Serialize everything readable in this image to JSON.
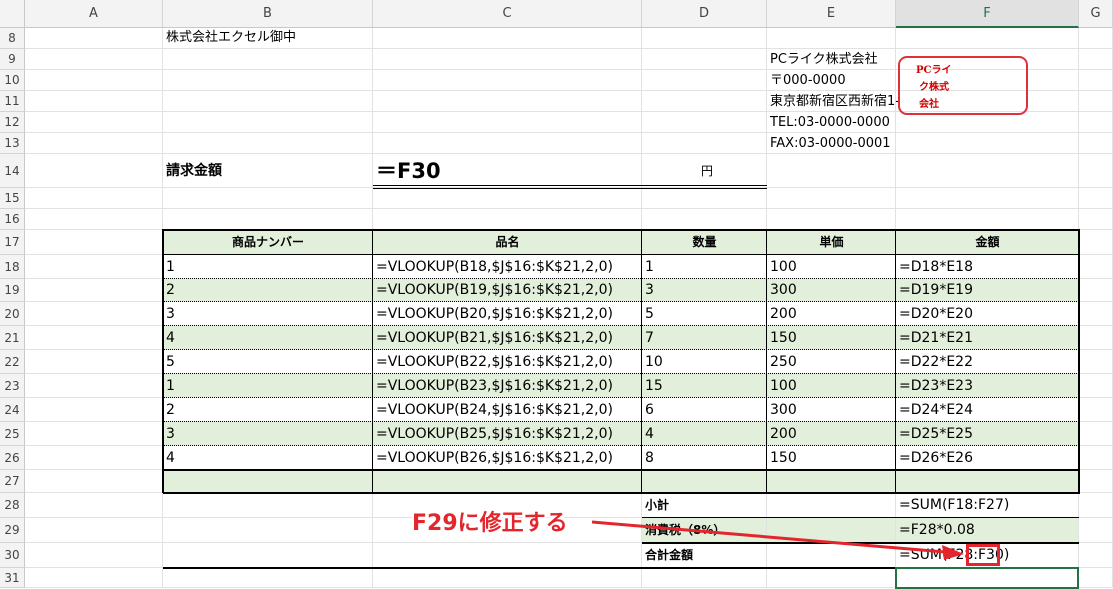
{
  "columns": [
    "A",
    "B",
    "C",
    "D",
    "E",
    "F",
    "G"
  ],
  "rows": [
    "8",
    "9",
    "10",
    "11",
    "12",
    "13",
    "14",
    "15",
    "16",
    "17",
    "18",
    "19",
    "20",
    "21",
    "22",
    "23",
    "24",
    "25",
    "26",
    "27",
    "28",
    "29",
    "30",
    "31"
  ],
  "selected_column": "F",
  "addressee": "株式会社エクセル御中",
  "company": {
    "name": "PCライク株式会社",
    "postal": "〒000-0000",
    "address": "東京都新宿区西新宿1-",
    "tel": "TEL:03-0000-0000",
    "fax": "FAX:03-0000-0001"
  },
  "stamp": {
    "line1": "PCライ",
    "line2": "ク株式",
    "line3": "会社",
    "color": "#e0303a"
  },
  "billing": {
    "label": "請求金額",
    "formula": "＝F30",
    "unit": "円"
  },
  "table": {
    "headers": [
      "商品ナンバー",
      "品名",
      "数量",
      "単価",
      "金額"
    ],
    "rows": [
      [
        "1",
        "=VLOOKUP(B18,$J$16:$K$21,2,0)",
        "1",
        "100",
        "=D18*E18"
      ],
      [
        "2",
        "=VLOOKUP(B19,$J$16:$K$21,2,0)",
        "3",
        "300",
        "=D19*E19"
      ],
      [
        "3",
        "=VLOOKUP(B20,$J$16:$K$21,2,0)",
        "5",
        "200",
        "=D20*E20"
      ],
      [
        "4",
        "=VLOOKUP(B21,$J$16:$K$21,2,0)",
        "7",
        "150",
        "=D21*E21"
      ],
      [
        "5",
        "=VLOOKUP(B22,$J$16:$K$21,2,0)",
        "10",
        "250",
        "=D22*E22"
      ],
      [
        "1",
        "=VLOOKUP(B23,$J$16:$K$21,2,0)",
        "15",
        "100",
        "=D23*E23"
      ],
      [
        "2",
        "=VLOOKUP(B24,$J$16:$K$21,2,0)",
        "6",
        "300",
        "=D24*E24"
      ],
      [
        "3",
        "=VLOOKUP(B25,$J$16:$K$21,2,0)",
        "4",
        "200",
        "=D25*E25"
      ],
      [
        "4",
        "=VLOOKUP(B26,$J$16:$K$21,2,0)",
        "8",
        "150",
        "=D26*E26"
      ]
    ],
    "header_fill": "#e2efda"
  },
  "summary": {
    "subtotal_label": "小計",
    "subtotal_formula": "=SUM(F18:F27)",
    "tax_label": "消費税（8%）",
    "tax_formula": "=F28*0.08",
    "total_label": "合計金額",
    "total_formula": "=SUM(F28:F30)"
  },
  "annotation": {
    "text": "F29に修正する",
    "color": "#e3262d"
  }
}
